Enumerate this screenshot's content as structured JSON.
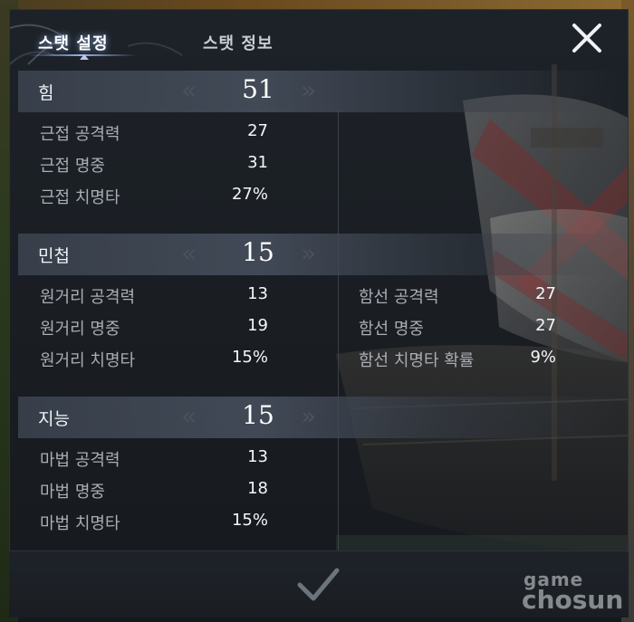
{
  "tabs": [
    {
      "label": "스탯 설정",
      "active": true
    },
    {
      "label": "스탯 정보",
      "active": false
    }
  ],
  "stats": [
    {
      "name": "힘",
      "value": "51",
      "rows": [
        {
          "label": "근접 공격력",
          "value": "27"
        },
        {
          "label": "근접 명중",
          "value": "31"
        },
        {
          "label": "근접 치명타",
          "value": "27%"
        }
      ]
    },
    {
      "name": "민첩",
      "value": "15",
      "rows": [
        {
          "label": "원거리 공격력",
          "value": "13"
        },
        {
          "label": "원거리 명중",
          "value": "19"
        },
        {
          "label": "원거리 치명타",
          "value": "15%"
        }
      ]
    },
    {
      "name": "지능",
      "value": "15",
      "rows": [
        {
          "label": "마법 공격력",
          "value": "13"
        },
        {
          "label": "마법 명중",
          "value": "18"
        },
        {
          "label": "마법 치명타",
          "value": "15%"
        }
      ]
    }
  ],
  "ship_stats": [
    {
      "label": "함선 공격력",
      "value": "27"
    },
    {
      "label": "함선 명중",
      "value": "27"
    },
    {
      "label": "함선 치명타 확률",
      "value": "9%"
    }
  ],
  "icons": {
    "close": "close-icon",
    "confirm": "checkmark-icon",
    "decrease": "double-chevron-left-icon",
    "increase": "double-chevron-right-icon"
  },
  "watermark": {
    "line1": "game",
    "line2": "chosun"
  },
  "colors": {
    "panel_bg": "#1b2026",
    "tab_glow": "#8caae6",
    "label_text": "#a9aeb4",
    "value_text": "#f5f6f7",
    "arrow": "#4a525c"
  }
}
